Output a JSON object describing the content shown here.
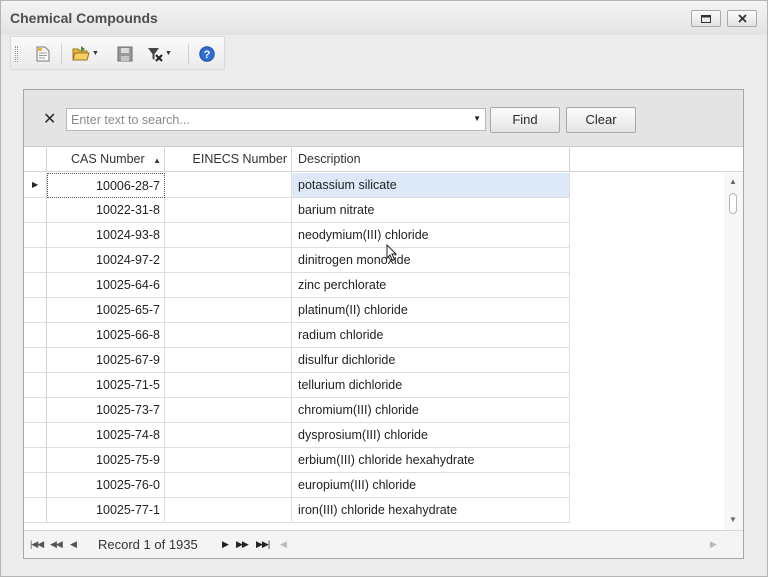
{
  "window": {
    "title": "Chemical Compounds"
  },
  "toolbar": {
    "icons": [
      "new-document-icon",
      "open-folder-icon",
      "save-disk-icon",
      "clear-filter-icon",
      "help-icon"
    ]
  },
  "find_panel": {
    "search_placeholder": "Enter text to search...",
    "search_value": "",
    "find_label": "Find",
    "clear_label": "Clear"
  },
  "grid": {
    "columns": [
      "CAS Number",
      "EINECS Number",
      "Description"
    ],
    "sort_column": "CAS Number",
    "sort_direction": "ascending",
    "rows": [
      {
        "cas": "10006-28-7",
        "einecs": "",
        "description": "potassium silicate"
      },
      {
        "cas": "10022-31-8",
        "einecs": "",
        "description": "barium nitrate"
      },
      {
        "cas": "10024-93-8",
        "einecs": "",
        "description": "neodymium(III) chloride"
      },
      {
        "cas": "10024-97-2",
        "einecs": "",
        "description": "dinitrogen monoxide"
      },
      {
        "cas": "10025-64-6",
        "einecs": "",
        "description": "zinc perchlorate"
      },
      {
        "cas": "10025-65-7",
        "einecs": "",
        "description": "platinum(II) chloride"
      },
      {
        "cas": "10025-66-8",
        "einecs": "",
        "description": "radium chloride"
      },
      {
        "cas": "10025-67-9",
        "einecs": "",
        "description": "disulfur dichloride"
      },
      {
        "cas": "10025-71-5",
        "einecs": "",
        "description": "tellurium dichloride"
      },
      {
        "cas": "10025-73-7",
        "einecs": "",
        "description": "chromium(III) chloride"
      },
      {
        "cas": "10025-74-8",
        "einecs": "",
        "description": "dysprosium(III) chloride"
      },
      {
        "cas": "10025-75-9",
        "einecs": "",
        "description": "erbium(III) chloride hexahydrate"
      },
      {
        "cas": "10025-76-0",
        "einecs": "",
        "description": "europium(III) chloride"
      },
      {
        "cas": "10025-77-1",
        "einecs": "",
        "description": "iron(III) chloride hexahydrate"
      }
    ],
    "selected_row": 0
  },
  "navigator": {
    "record_text": "Record 1 of 1935"
  },
  "colors": {
    "selection": "#dde8f8",
    "grid_line": "#dedede",
    "help_icon": "#2f6fd0"
  }
}
